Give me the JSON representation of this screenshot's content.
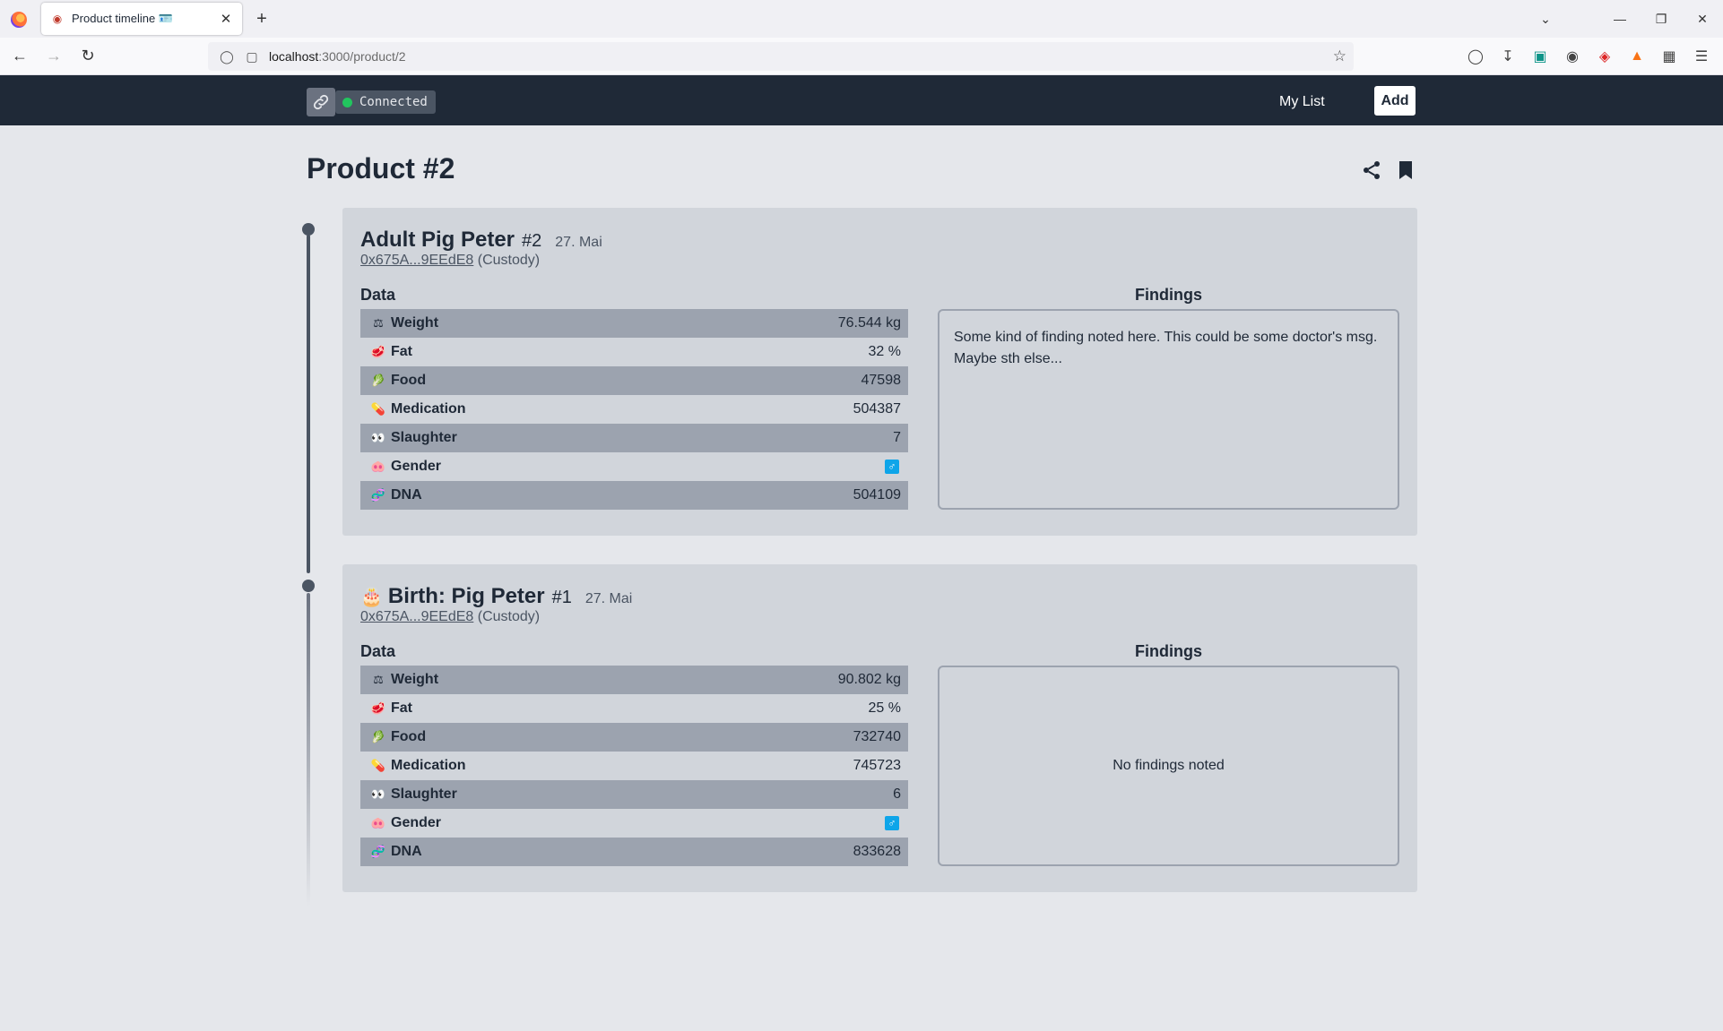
{
  "browser": {
    "tab_title": "Product timeline 🪪",
    "url_host": "localhost",
    "url_path": ":3000/product/2"
  },
  "header": {
    "status": "Connected",
    "nav_my_list": "My List",
    "add_label": "Add",
    "status_color": "#22c55e"
  },
  "page": {
    "title": "Product #2"
  },
  "entries": [
    {
      "name": "Adult Pig Peter",
      "number": "#2",
      "date": "27. Mai",
      "address": "0x675A...9EEdE8",
      "role": "(Custody)",
      "data_label": "Data",
      "findings_label": "Findings",
      "findings": "Some kind of finding noted here. This could be some doctor's msg. Maybe sth else...",
      "rows": [
        {
          "icon": "weight-icon",
          "glyph": "⚖",
          "label": "Weight",
          "value": "76.544 kg"
        },
        {
          "icon": "fat-icon",
          "glyph": "🥩",
          "label": "Fat",
          "value": "32 %"
        },
        {
          "icon": "food-icon",
          "glyph": "🥬",
          "label": "Food",
          "value": "47598"
        },
        {
          "icon": "medication-icon",
          "glyph": "💊",
          "label": "Medication",
          "value": "504387"
        },
        {
          "icon": "slaughter-icon",
          "glyph": "👀",
          "label": "Slaughter",
          "value": "7"
        },
        {
          "icon": "gender-nose-icon",
          "glyph": "🐽",
          "label": "Gender",
          "value": "♂"
        },
        {
          "icon": "dna-icon",
          "glyph": "🧬",
          "label": "DNA",
          "value": "504109"
        }
      ]
    },
    {
      "prefix_icon": "cake-icon",
      "name": "Birth: Pig Peter",
      "number": "#1",
      "date": "27. Mai",
      "address": "0x675A...9EEdE8",
      "role": "(Custody)",
      "data_label": "Data",
      "findings_label": "Findings",
      "findings": "No findings noted",
      "rows": [
        {
          "icon": "weight-icon",
          "glyph": "⚖",
          "label": "Weight",
          "value": "90.802 kg"
        },
        {
          "icon": "fat-icon",
          "glyph": "🥩",
          "label": "Fat",
          "value": "25 %"
        },
        {
          "icon": "food-icon",
          "glyph": "🥬",
          "label": "Food",
          "value": "732740"
        },
        {
          "icon": "medication-icon",
          "glyph": "💊",
          "label": "Medication",
          "value": "745723"
        },
        {
          "icon": "slaughter-icon",
          "glyph": "👀",
          "label": "Slaughter",
          "value": "6"
        },
        {
          "icon": "gender-nose-icon",
          "glyph": "🐽",
          "label": "Gender",
          "value": "♂"
        },
        {
          "icon": "dna-icon",
          "glyph": "🧬",
          "label": "DNA",
          "value": "833628"
        }
      ]
    }
  ]
}
